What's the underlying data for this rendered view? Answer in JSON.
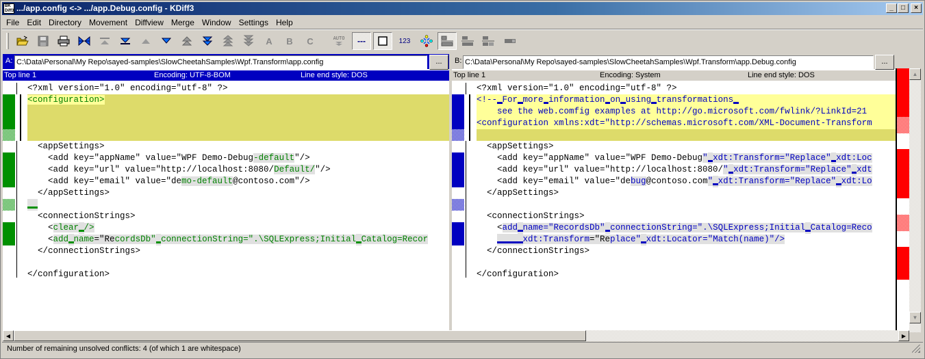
{
  "window": {
    "title": ".../app.config <-> .../app.Debug.config - KDiff3",
    "controls": {
      "minimize": "_",
      "maximize": "□",
      "close": "×"
    }
  },
  "menu": [
    "File",
    "Edit",
    "Directory",
    "Movement",
    "Diffview",
    "Merge",
    "Window",
    "Settings",
    "Help"
  ],
  "toolbar": {
    "buttons": [
      {
        "name": "open-icon"
      },
      {
        "name": "save-icon"
      },
      {
        "name": "print-icon"
      },
      {
        "name": "go-current-delta-icon"
      },
      {
        "name": "go-top-icon"
      },
      {
        "name": "go-bottom-icon"
      },
      {
        "name": "go-prev-delta-icon"
      },
      {
        "name": "go-next-delta-icon"
      },
      {
        "name": "go-prev-conflict-icon"
      },
      {
        "name": "go-next-conflict-icon"
      },
      {
        "name": "go-prev-unsolved-conflict-icon"
      },
      {
        "name": "go-next-unsolved-conflict-icon"
      },
      {
        "name": "select-a-icon",
        "label": "A"
      },
      {
        "name": "select-b-icon",
        "label": "B"
      },
      {
        "name": "select-c-icon",
        "label": "C"
      },
      {
        "name": "auto-advance-icon",
        "label": "AUTO"
      },
      {
        "name": "show-whitespace-chars-icon",
        "label": "---"
      },
      {
        "name": "show-whitespace-icon"
      },
      {
        "name": "show-line-numbers-icon",
        "label": "123"
      },
      {
        "name": "choose-a-everywhere-icon"
      },
      {
        "name": "toggle-split-orientation-icon"
      },
      {
        "name": "dir-view-icon"
      },
      {
        "name": "merge-view-icon"
      },
      {
        "name": "overview-icon"
      }
    ],
    "labels": {
      "a": "A",
      "b": "B",
      "c": "C",
      "auto": "AUTO",
      "ws": "---",
      "num": "123"
    }
  },
  "paneA": {
    "label": "A:",
    "path": "C:\\Data\\Personal\\My Repo\\sayed-samples\\SlowCheetahSamples\\Wpf.Transform\\app.config",
    "browse": "...",
    "top_line": "Top line 1",
    "encoding": "Encoding: UTF-8-BOM",
    "line_end": "Line end style: DOS",
    "accent": "#0000c0",
    "diff_color": "#008000",
    "lines": [
      "<?xml version=\"1.0\" encoding=\"utf-8\" ?>",
      "<configuration>",
      "",
      "",
      "",
      "  <appSettings>",
      "    <add key=\"appName\" value=\"WPF Demo-Debug",
      "-default",
      "\"/>",
      "    <add key=\"url\" value=\"http://localhost:8080/",
      "Default/",
      "\"/>",
      "    <add key=\"email\" value=\"de",
      "mo-default",
      "@contoso.com\"/>",
      "  </appSettings>",
      "",
      "  <connectionStrings>",
      "    <",
      "clear",
      "/>",
      "    <",
      "add",
      "name",
      "=\"Re",
      "cordsDb\"",
      "connectionString=\".\\SQLExpress;Initial",
      "Catalog=Recor",
      "  </connectionStrings>",
      "",
      "</configuration>"
    ]
  },
  "paneB": {
    "label": "B:",
    "path": "C:\\Data\\Personal\\My Repo\\sayed-samples\\SlowCheetahSamples\\Wpf.Transform\\app.Debug.config",
    "browse": "...",
    "top_line": "Top line 1",
    "encoding": "Encoding: System",
    "line_end": "Line end style: DOS",
    "diff_color": "#0000c0",
    "lines": [
      "<?xml version=\"1.0\" encoding=\"utf-8\" ?>",
      "<!--",
      "For",
      "more",
      "information",
      "on",
      "using",
      "transformations",
      "    see the web.comfig examples at http://go.microsoft.com/fwlink/?LinkId=21",
      "<configuration xmlns:xdt=\"http://schemas.microsoft.com/XML-Document-Transform",
      "  <appSettings>",
      "    <add key=\"appName\" value=\"WPF Demo-Debug",
      "\"",
      "xdt:Transform=\"Replace\"",
      "xdt:Loc",
      "    <add key=\"url\" value=\"http://localhost:8080/",
      "xdt",
      "    <add key=\"email\" value=\"de",
      "bug",
      "@contoso.com",
      "xdt:Lo",
      "  </appSettings>",
      "  <connectionStrings>",
      "    <",
      "add",
      "name=\"RecordsDb\"",
      "connectionString=\".\\SQLExpress;Initial",
      "Catalog=Reco",
      "xdt:Transform",
      "=\"Re",
      "place\"",
      "xdt:Locator=\"Match(name)\"/>",
      "  </connectionStrings>",
      "</configuration>"
    ]
  },
  "status": {
    "text": "Number of remaining unsolved conflicts: 4 (of which 1 are whitespace)"
  },
  "colors": {
    "conflict_bg": "#dddb6a",
    "conflict_line": "#ffff99",
    "overview_conflict": "#ff0000",
    "pane_header_active": "#0000c0"
  }
}
